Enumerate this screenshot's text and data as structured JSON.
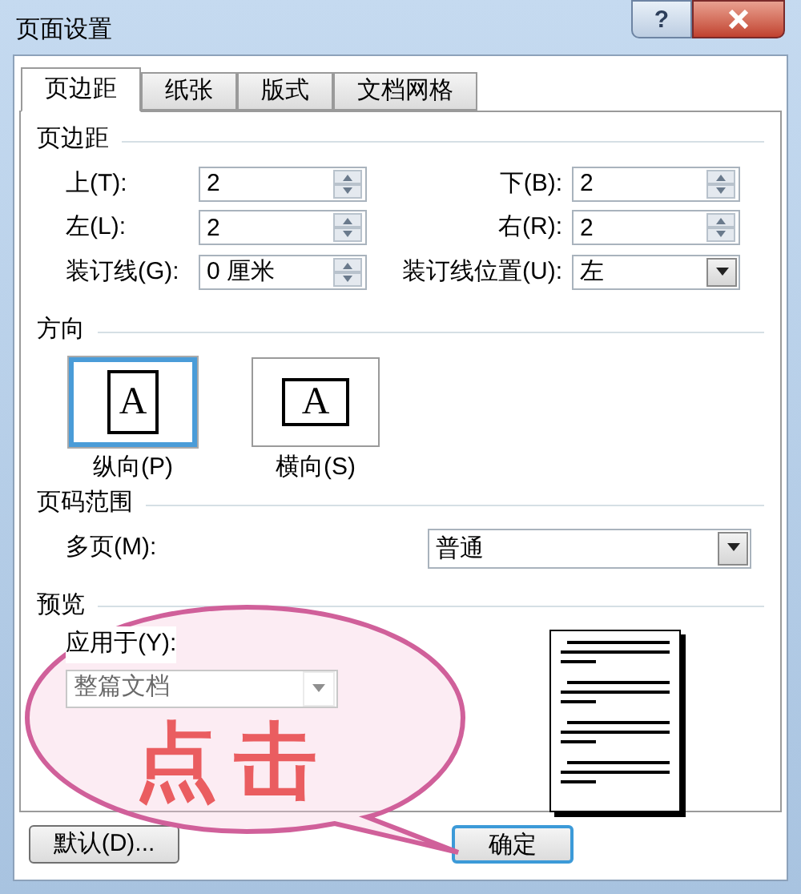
{
  "window": {
    "title": "页面设置",
    "help": "?"
  },
  "tabs": [
    {
      "label": "页边距",
      "selected": true
    },
    {
      "label": "纸张",
      "selected": false
    },
    {
      "label": "版式",
      "selected": false
    },
    {
      "label": "文档网格",
      "selected": false
    }
  ],
  "margins": {
    "heading": "页边距",
    "fields": [
      {
        "label": "上(T):",
        "value": "2",
        "kind": "spin"
      },
      {
        "label": "下(B):",
        "value": "2",
        "kind": "spin"
      },
      {
        "label": "左(L):",
        "value": "2",
        "kind": "spin"
      },
      {
        "label": "右(R):",
        "value": "2",
        "kind": "spin"
      },
      {
        "label": "装订线(G):",
        "value": "0 厘米",
        "kind": "spin"
      },
      {
        "label": "装订线位置(U):",
        "value": "左",
        "kind": "select"
      }
    ]
  },
  "orientation": {
    "heading": "方向",
    "options": [
      {
        "label": "纵向(P)",
        "glyph": "A",
        "kind": "portrait",
        "selected": true
      },
      {
        "label": "横向(S)",
        "glyph": "A",
        "kind": "landscape",
        "selected": false
      }
    ]
  },
  "pages": {
    "heading": "页码范围",
    "label": "多页(M):",
    "value": "普通"
  },
  "preview": {
    "heading": "预览",
    "apply_label": "应用于(Y):",
    "apply_value": "整篇文档",
    "apply_disabled": true
  },
  "buttons": [
    {
      "label": "默认(D)...",
      "default": false
    },
    {
      "label": "确定",
      "default": true
    }
  ],
  "callout": {
    "text": "点击"
  }
}
